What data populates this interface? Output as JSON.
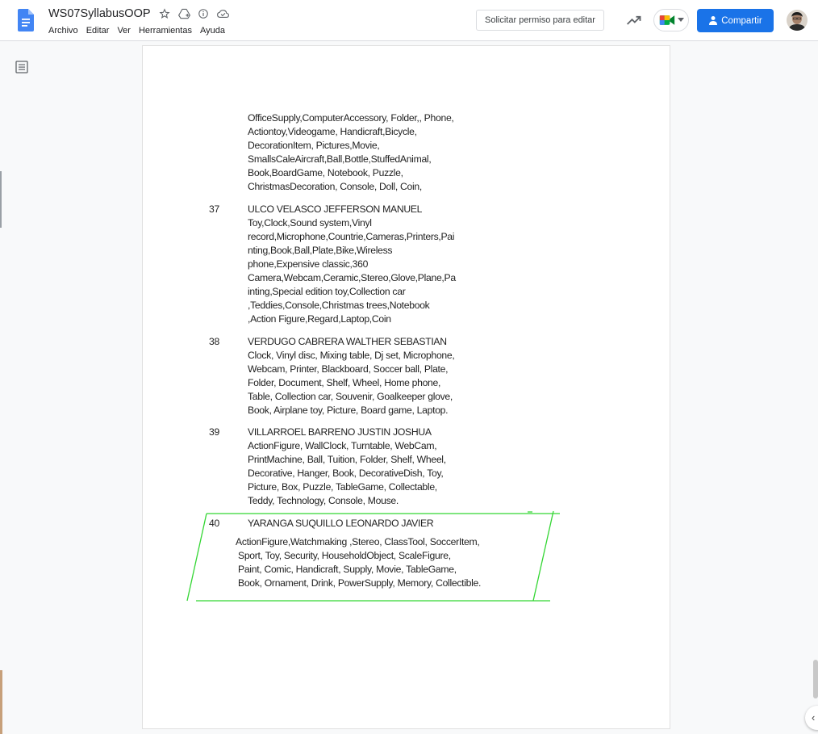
{
  "header": {
    "title": "WS07SyllabusOOP",
    "menu": [
      "Archivo",
      "Editar",
      "Ver",
      "Herramientas",
      "Ayuda"
    ],
    "request_edit_label": "Solicitar permiso para editar",
    "share_label": "Compartir"
  },
  "colors": {
    "share_blue": "#1a73e8",
    "annotation_green": "#33d633"
  },
  "document": {
    "entry_36_continued": [
      "OfficeSupply,ComputerAccessory, Folder,, Phone,",
      "Actiontoy,Videogame, Handicraft,Bicycle,",
      "DecorationItem, Pictures,Movie,",
      "SmallsCaleAircraft,Ball,Bottle,StuffedAnimal,",
      "Book,BoardGame, Notebook, Puzzle,",
      "ChristmasDecoration, Console, Doll, Coin,"
    ],
    "entries": [
      {
        "number": "37",
        "lines": [
          "ULCO VELASCO JEFFERSON MANUEL",
          "Toy,Clock,Sound system,Vinyl",
          "record,Microphone,Countrie,Cameras,Printers,Pai",
          "nting,Book,Ball,Plate,Bike,Wireless",
          "phone,Expensive classic,360",
          "Camera,Webcam,Ceramic,Stereo,Glove,Plane,Pa",
          "inting,Special edition toy,Collection car",
          ",Teddies,Console,Christmas trees,Notebook",
          ",Action Figure,Regard,Laptop,Coin"
        ]
      },
      {
        "number": "38",
        "lines": [
          "VERDUGO CABRERA WALTHER SEBASTIAN",
          "Clock, Vinyl disc, Mixing table, Dj set, Microphone,",
          "Webcam, Printer, Blackboard, Soccer ball, Plate,",
          "Folder, Document, Shelf, Wheel, Home phone,",
          "Table, Collection car, Souvenir, Goalkeeper glove,",
          "Book, Airplane toy, Picture, Board game, Laptop."
        ]
      },
      {
        "number": "39",
        "lines": [
          "VILLARROEL BARRENO JUSTIN JOSHUA",
          "ActionFigure, WallClock, Turntable, WebCam,",
          "PrintMachine, Ball, Tuition, Folder, Shelf, Wheel,",
          "Decorative, Hanger, Book, DecorativeDish, Toy,",
          "Picture, Box, Puzzle, TableGame, Collectable,",
          "Teddy, Technology, Console, Mouse."
        ]
      },
      {
        "number": "40",
        "name": "YARANGA SUQUILLO LEONARDO JAVIER",
        "lines": [
          "ActionFigure,Watchmaking ,Stereo, ClassTool, SoccerItem,",
          "Sport, Toy, Security, HouseholdObject, ScaleFigure,",
          "Paint, Comic, Handicraft, Supply, Movie, TableGame,",
          "Book, Ornament, Drink, PowerSupply, Memory, Collectible."
        ]
      }
    ]
  }
}
